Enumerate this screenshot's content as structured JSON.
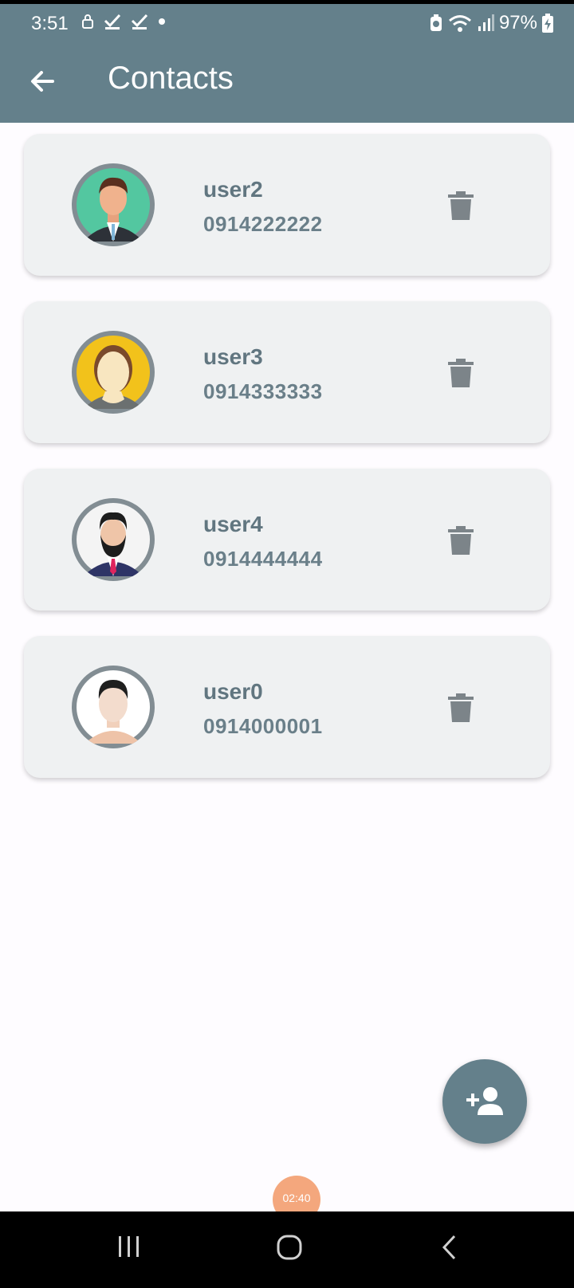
{
  "status_bar": {
    "time": "3:51",
    "battery": "97%"
  },
  "header": {
    "title": "Contacts"
  },
  "contacts": [
    {
      "name": "user2",
      "phone": "0914222222"
    },
    {
      "name": "user3",
      "phone": "0914333333"
    },
    {
      "name": "user4",
      "phone": "0914444444"
    },
    {
      "name": "user0",
      "phone": "0914000001"
    }
  ],
  "recording_timer": "02:40",
  "colors": {
    "appbar": "#64808b",
    "card": "#eff1f2",
    "text": "#617680",
    "accent_timer": "#f4a77d"
  }
}
